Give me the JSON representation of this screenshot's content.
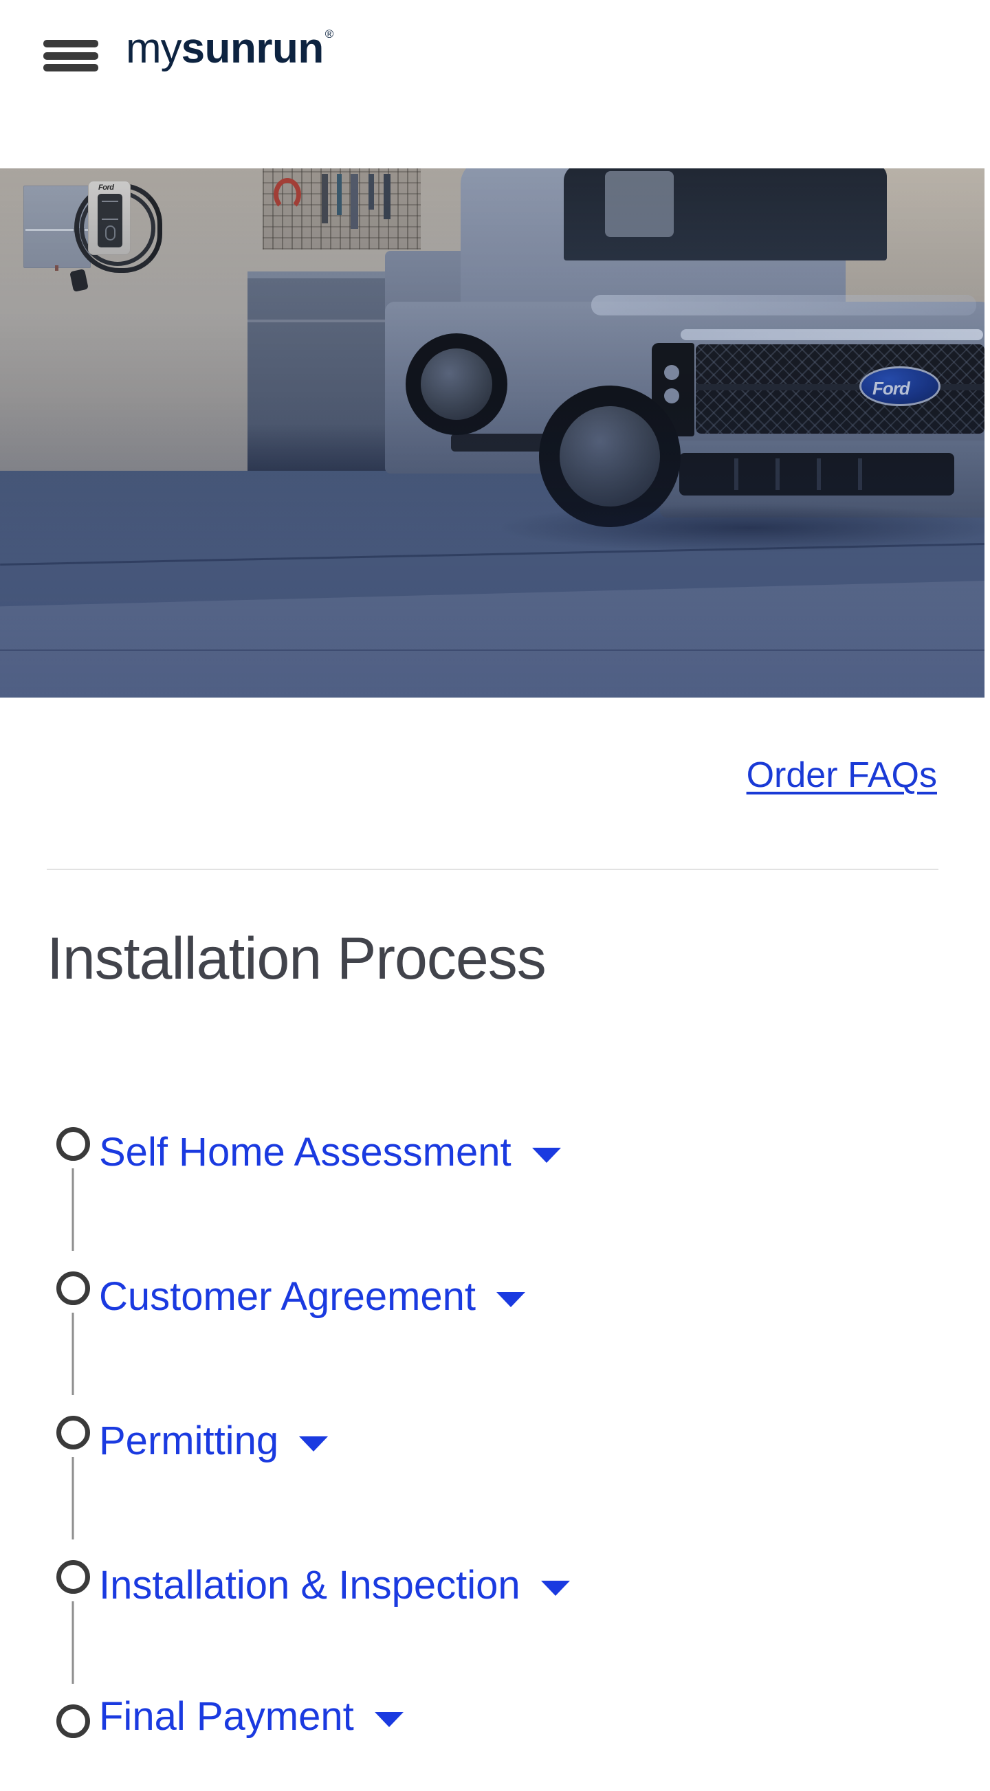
{
  "header": {
    "menu_icon": "hamburger-menu-icon",
    "brand_prefix": "my",
    "brand_name": "sunrun",
    "brand_trademark": "®"
  },
  "hero": {
    "alt": "ford-f150-lightning-truck-in-garage-with-ev-charger",
    "charger_brand": "Ford",
    "vehicle_badge": "Ford",
    "tint_color": "#2a3e70"
  },
  "links": {
    "order_faqs": "Order FAQs"
  },
  "main": {
    "title": "Installation Process"
  },
  "timeline": {
    "steps": [
      {
        "label": "Self Home Assessment",
        "state": "incomplete",
        "expanded": false
      },
      {
        "label": "Customer Agreement",
        "state": "incomplete",
        "expanded": false
      },
      {
        "label": "Permitting",
        "state": "incomplete",
        "expanded": false
      },
      {
        "label": "Installation & Inspection",
        "state": "incomplete",
        "expanded": false
      },
      {
        "label": "Final Payment",
        "state": "incomplete",
        "expanded": false
      }
    ]
  },
  "colors": {
    "brand_navy": "#0d2340",
    "link_blue": "#1a3ad6",
    "step_blue": "#1a3ae0",
    "heading_gray": "#41434b",
    "circle_gray": "#3a3a3a",
    "connector_gray": "#8e8e8e",
    "divider_gray": "#e2e2e2"
  }
}
